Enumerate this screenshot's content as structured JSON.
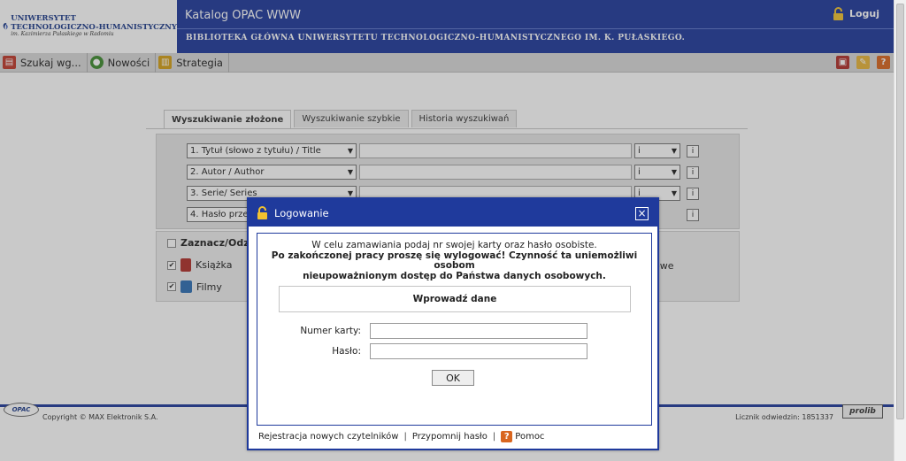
{
  "header": {
    "logo": {
      "line1": "UNIWERSYTET",
      "line2": "TECHNOLOGICZNO-HUMANISTYCZNY",
      "line3": "im. Kazimierza Pułaskiego w Radomiu"
    },
    "title": "Katalog OPAC WWW",
    "subtitle": "BIBLIOTEKA GŁÓWNA UNIWERSYTETU TECHNOLOGICZNO-HUMANISTYCZNEGO IM. K. PUŁASKIEGO.",
    "login_label": "Loguj"
  },
  "toolbar": {
    "items": [
      {
        "label": "Szukaj wg...",
        "icon": "search-book-icon"
      },
      {
        "label": "Nowości",
        "icon": "new-items-icon"
      },
      {
        "label": "Strategia",
        "icon": "strategy-icon"
      }
    ],
    "right_icons": [
      "basket-icon",
      "notes-icon",
      "help-icon"
    ]
  },
  "search": {
    "tabs": [
      {
        "label": "Wyszukiwanie złożone",
        "active": true
      },
      {
        "label": "Wyszukiwanie szybkie",
        "active": false
      },
      {
        "label": "Historia wyszukiwań",
        "active": false
      }
    ],
    "rows": [
      {
        "field": "1. Tytuł (słowo z tytułu) / Title",
        "op": "i"
      },
      {
        "field": "2. Autor / Author",
        "op": "i"
      },
      {
        "field": "3. Serie/ Series",
        "op": "i"
      },
      {
        "field": "4. Hasło prze",
        "op": ""
      }
    ],
    "info_label": "i"
  },
  "types": {
    "select_all_label": "Zaznacz/Odzn",
    "books_label": "Książka",
    "films_label": "Filmy",
    "partial_label": "kowe"
  },
  "footer": {
    "badge": "OPAC",
    "copyright": "Copyright © MAX Elektronik S.A.",
    "counter": "Licznik odwiedzin: 1851337",
    "brand": "prolib"
  },
  "modal": {
    "title": "Logowanie",
    "close_glyph": "×",
    "info_line1": "W celu zamawiania podaj nr swojej karty oraz hasło osobiste.",
    "info_line2": "Po zakończonej pracy proszę się wylogować! Czynność ta uniemożliwi osobom",
    "info_line3": "nieupoważnionym dostęp do Państwa danych osobowych.",
    "enter_data": "Wprowadź dane",
    "card_label": "Numer karty:",
    "card_value": "",
    "password_label": "Hasło:",
    "password_value": "",
    "ok_label": "OK",
    "link_register": "Rejestracja nowych czytelników",
    "link_remind": "Przypomnij hasło",
    "link_help": "Pomoc",
    "separator": "|"
  },
  "colors": {
    "brand_blue": "#1f3a9c",
    "toolbar_gray": "#d9d9d9"
  }
}
